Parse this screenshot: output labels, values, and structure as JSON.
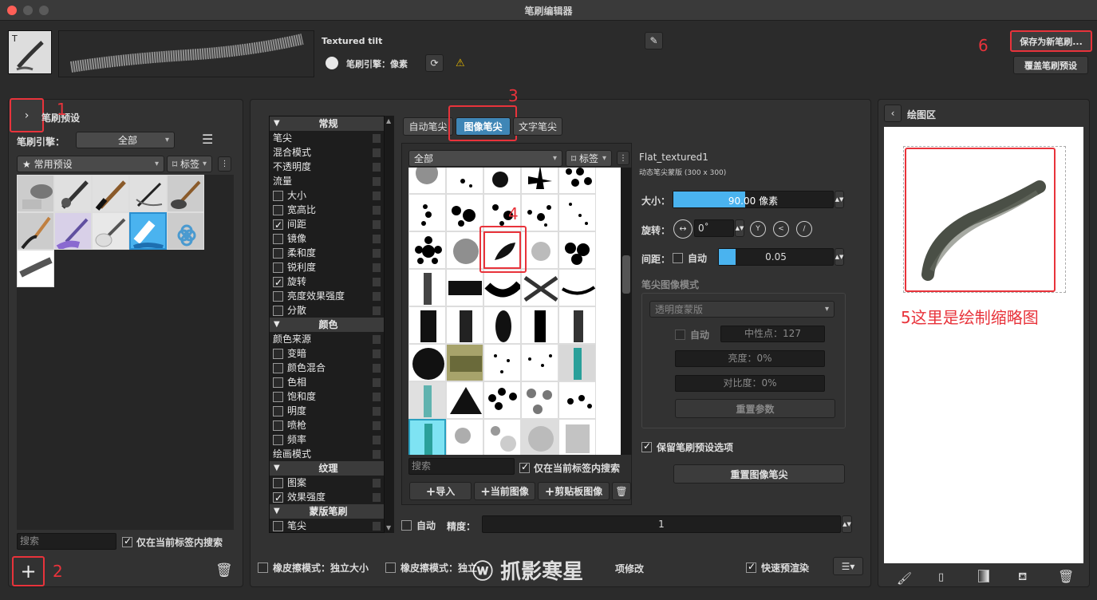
{
  "window": {
    "title": "笔刷编辑器"
  },
  "header": {
    "brush_name": "Textured tilt",
    "engine_label": "笔刷引擎：像素",
    "save_new": "保存为新笔刷...",
    "overwrite": "覆盖笔刷预设"
  },
  "left": {
    "title": "笔刷预设",
    "engine_label": "笔刷引擎：",
    "engine_value": "全部",
    "preset_tag": "★ 常用预设",
    "tag_btn": "标签",
    "search_placeholder": "搜索",
    "search_in_tag": "仅在当前标签内搜索"
  },
  "props": {
    "sections": [
      {
        "head": "常规",
        "items": [
          {
            "label": "笔尖",
            "cb": null
          },
          {
            "label": "混合模式",
            "cb": null
          },
          {
            "label": "不透明度",
            "cb": null
          },
          {
            "label": "流量",
            "cb": null
          },
          {
            "label": "大小",
            "cb": false
          },
          {
            "label": "宽高比",
            "cb": false
          },
          {
            "label": "间距",
            "cb": true
          },
          {
            "label": "镜像",
            "cb": false
          },
          {
            "label": "柔和度",
            "cb": false
          },
          {
            "label": "锐利度",
            "cb": false
          },
          {
            "label": "旋转",
            "cb": true
          },
          {
            "label": "亮度效果强度",
            "cb": false
          },
          {
            "label": "分散",
            "cb": false
          }
        ]
      },
      {
        "head": "颜色",
        "items": [
          {
            "label": "颜色来源",
            "cb": null
          },
          {
            "label": "变暗",
            "cb": false
          },
          {
            "label": "颜色混合",
            "cb": false
          },
          {
            "label": "色相",
            "cb": false
          },
          {
            "label": "饱和度",
            "cb": false
          },
          {
            "label": "明度",
            "cb": false
          },
          {
            "label": "喷枪",
            "cb": false
          },
          {
            "label": "频率",
            "cb": false
          },
          {
            "label": "绘画模式",
            "cb": null
          }
        ]
      },
      {
        "head": "纹理",
        "items": [
          {
            "label": "图案",
            "cb": false
          },
          {
            "label": "效果强度",
            "cb": true
          }
        ]
      },
      {
        "head": "蒙版笔刷",
        "items": [
          {
            "label": "笔尖",
            "cb": false
          }
        ]
      }
    ]
  },
  "tip": {
    "tabs": [
      "自动笔尖",
      "图像笔尖",
      "文字笔尖"
    ],
    "filter": "全部",
    "tag_btn": "标签",
    "search_placeholder": "搜索",
    "search_in_tag": "仅在当前标签内搜索",
    "import": "导入",
    "current_image": "当前图像",
    "clipboard_image": "剪贴板图像",
    "auto": "自动",
    "precision_label": "精度：",
    "precision_value": "1"
  },
  "tip_settings": {
    "name": "Flat_textured1",
    "desc": "动态笔尖蒙版 (300 x 300)",
    "size_label": "大小：",
    "size_value": "90.00 像素",
    "size_fill": 0.45,
    "rotation_label": "旋转：",
    "rotation_value": "0˚",
    "spacing_label": "间距：",
    "spacing_auto": "自动",
    "spacing_value": "0.05",
    "image_mode_label": "笔尖图像模式",
    "mask_mode": "透明度蒙版",
    "mid_auto": "自动",
    "midpoint": "中性点：127",
    "brightness": "亮度：0%",
    "contrast": "对比度：0%",
    "reset_params": "重置参数",
    "keep_preset": "保留笔刷预设选项",
    "reset_tip": "重置图像笔尖"
  },
  "draw": {
    "title": "绘图区"
  },
  "bottom": {
    "eraser1": "橡皮擦模式：独立大小",
    "eraser2": "橡皮擦模式：独立",
    "eraser2_tail": "项修改",
    "quick_preview": "快速预渲染"
  },
  "annotations": {
    "n1": "1",
    "n2": "2",
    "n3": "3",
    "n4": "4",
    "n5": "5这里是绘制缩略图",
    "n6": "6"
  },
  "watermark": "抓影寒星",
  "colors": {
    "accent": "#4ab3ef",
    "annot": "#e8333b"
  }
}
